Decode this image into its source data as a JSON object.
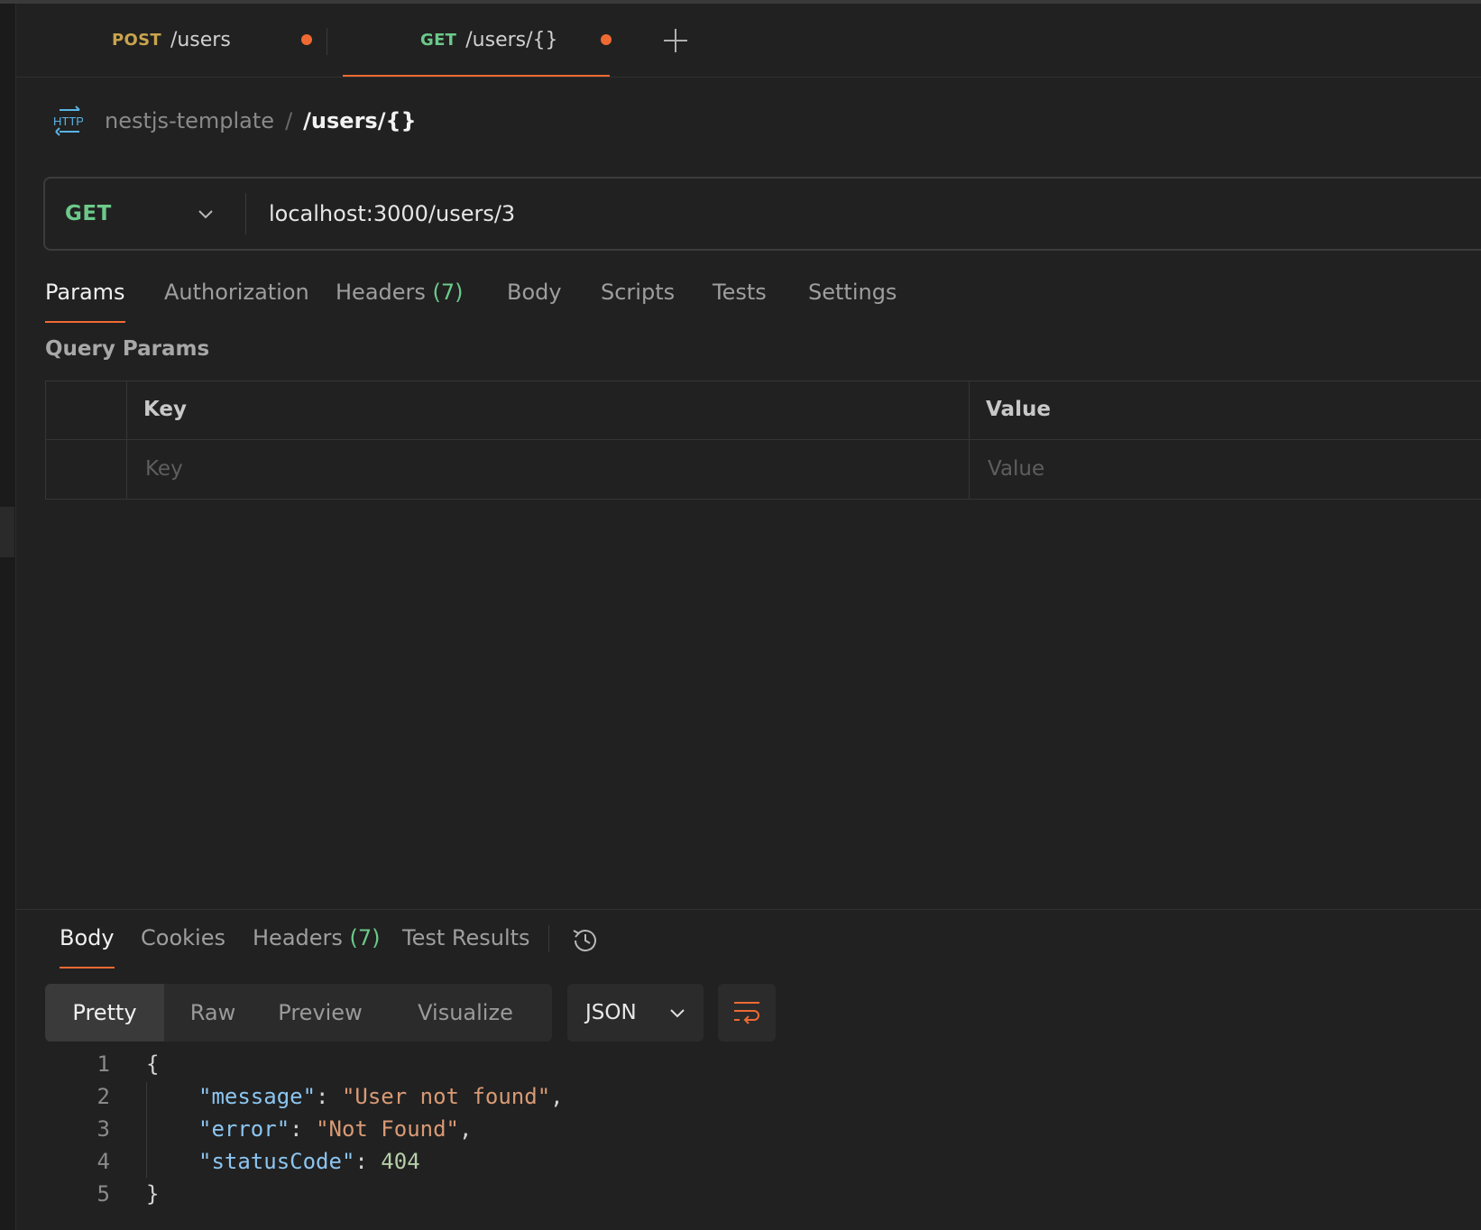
{
  "tabs": [
    {
      "method": "POST",
      "method_color": "#c9a44d",
      "path": "/users",
      "unsaved": true,
      "active": false
    },
    {
      "method": "GET",
      "method_color": "#6cc98a",
      "path": "/users/{}",
      "unsaved": true,
      "active": true
    }
  ],
  "breadcrumb": {
    "icon": "http-icon",
    "collection": "nestjs-template",
    "separator": "/",
    "current": "/users/{}"
  },
  "request": {
    "method": "GET",
    "url": "localhost:3000/users/3"
  },
  "request_tabs": {
    "params": "Params",
    "authorization": "Authorization",
    "headers": "Headers",
    "headers_count": "(7)",
    "body": "Body",
    "scripts": "Scripts",
    "tests": "Tests",
    "settings": "Settings",
    "active": "Params"
  },
  "query_params": {
    "title": "Query Params",
    "columns": {
      "key": "Key",
      "value": "Value"
    },
    "placeholders": {
      "key": "Key",
      "value": "Value"
    }
  },
  "response_tabs": {
    "body": "Body",
    "cookies": "Cookies",
    "headers": "Headers",
    "headers_count": "(7)",
    "test_results": "Test Results",
    "active": "Body"
  },
  "view_modes": {
    "pretty": "Pretty",
    "raw": "Raw",
    "preview": "Preview",
    "visualize": "Visualize",
    "active": "Pretty"
  },
  "format": "JSON",
  "response_body": {
    "line_numbers": [
      "1",
      "2",
      "3",
      "4",
      "5"
    ],
    "open_brace": "{",
    "close_brace": "}",
    "fields": [
      {
        "key": "\"message\"",
        "value": "\"User not found\"",
        "trail": ","
      },
      {
        "key": "\"error\"",
        "value": "\"Not Found\"",
        "trail": ","
      },
      {
        "key": "\"statusCode\"",
        "value": "404",
        "trail": ""
      }
    ]
  },
  "colors": {
    "accent": "#ef6a33",
    "get": "#6cc98a",
    "post": "#c9a44d",
    "json_key": "#8cc5f0",
    "json_string": "#d99a75",
    "json_number": "#b5cea8"
  }
}
